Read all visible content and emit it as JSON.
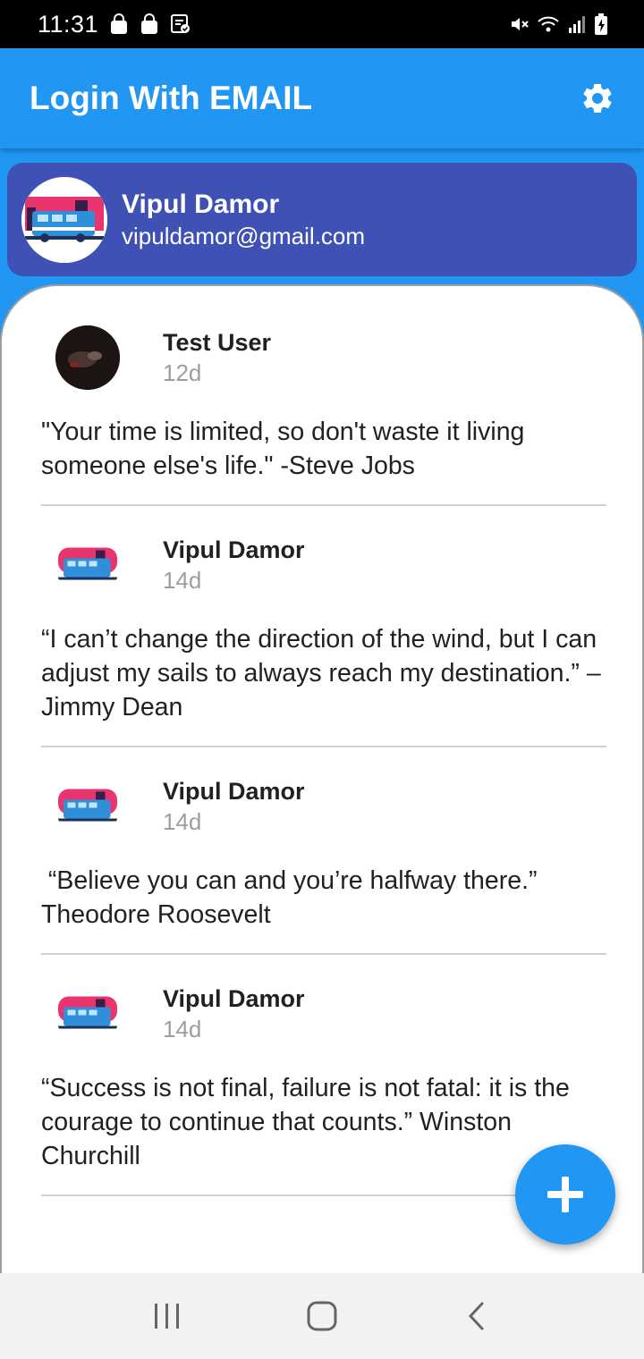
{
  "status_bar": {
    "time": "11:31",
    "left_icons": [
      "shopping-bag-icon",
      "shopping-bag-icon",
      "clipboard-check-icon"
    ],
    "right_icons": [
      "mute-icon",
      "wifi-icon",
      "signal-icon",
      "battery-charging-icon"
    ]
  },
  "app_bar": {
    "title": "Login With EMAIL",
    "action_icon": "gear-icon",
    "color": "#2196F3"
  },
  "profile": {
    "name": "Vipul Damor",
    "email": "vipuldamor@gmail.com",
    "background": "#3F51B5"
  },
  "posts": [
    {
      "user": "Test User",
      "time": "12d",
      "quote": "\"Your time is limited, so don't waste it living someone else's life.\" -Steve Jobs"
    },
    {
      "user": "Vipul Damor",
      "time": "14d",
      "quote": "“I can’t change the direction of the wind, but I can adjust my sails to always reach my destination.” – Jimmy Dean"
    },
    {
      "user": "Vipul Damor",
      "time": "14d",
      "quote": " “Believe you can and you’re halfway there.” Theodore Roosevelt"
    },
    {
      "user": "Vipul Damor",
      "time": "14d",
      "quote": "“Success is not final, failure is not fatal: it is the courage to continue that counts.” Winston Churchill"
    }
  ],
  "fab": {
    "icon": "plus-icon"
  },
  "nav_bar": {
    "icons": [
      "recent-apps-icon",
      "home-icon",
      "back-icon"
    ]
  }
}
